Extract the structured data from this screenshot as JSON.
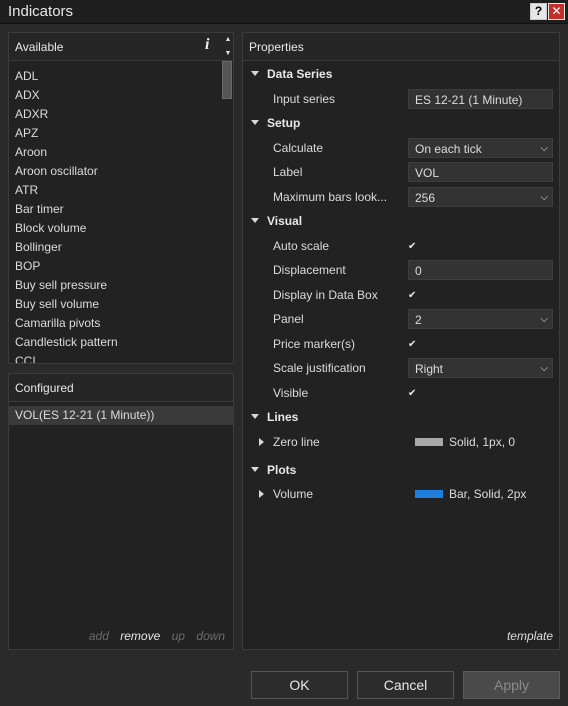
{
  "window": {
    "title": "Indicators",
    "help_label": "?",
    "close_label": "✕"
  },
  "available": {
    "header": "Available",
    "info_label": "i",
    "items": [
      "ADL",
      "ADX",
      "ADXR",
      "APZ",
      "Aroon",
      "Aroon oscillator",
      "ATR",
      "Bar timer",
      "Block volume",
      "Bollinger",
      "BOP",
      "Buy sell pressure",
      "Buy sell volume",
      "Camarilla pivots",
      "Candlestick pattern",
      "CCI"
    ]
  },
  "configured": {
    "header": "Configured",
    "items": [
      "VOL(ES 12-21 (1 Minute))"
    ],
    "actions": {
      "add": "add",
      "remove": "remove",
      "up": "up",
      "down": "down"
    }
  },
  "properties": {
    "header": "Properties",
    "data_series": {
      "label": "Data Series",
      "input_series": {
        "label": "Input series",
        "value": "ES 12-21 (1 Minute)"
      }
    },
    "setup": {
      "label": "Setup",
      "calculate": {
        "label": "Calculate",
        "value": "On each tick"
      },
      "label_field": {
        "label": "Label",
        "value": "VOL"
      },
      "max_bars": {
        "label": "Maximum bars look...",
        "value": "256"
      }
    },
    "visual": {
      "label": "Visual",
      "auto_scale": {
        "label": "Auto scale",
        "checked": true
      },
      "displacement": {
        "label": "Displacement",
        "value": "0"
      },
      "display_in_data_box": {
        "label": "Display in Data Box",
        "checked": true
      },
      "panel": {
        "label": "Panel",
        "value": "2"
      },
      "price_markers": {
        "label": "Price marker(s)",
        "checked": true
      },
      "scale_justification": {
        "label": "Scale justification",
        "value": "Right"
      },
      "visible": {
        "label": "Visible",
        "checked": true
      }
    },
    "lines": {
      "label": "Lines",
      "zero_line": {
        "label": "Zero line",
        "value": "Solid, 1px, 0",
        "color": "#a8a8a8"
      }
    },
    "plots": {
      "label": "Plots",
      "volume": {
        "label": "Volume",
        "value": "Bar, Solid, 2px",
        "color": "#1e7fe0"
      }
    },
    "template_label": "template"
  },
  "buttons": {
    "ok": "OK",
    "cancel": "Cancel",
    "apply": "Apply"
  }
}
